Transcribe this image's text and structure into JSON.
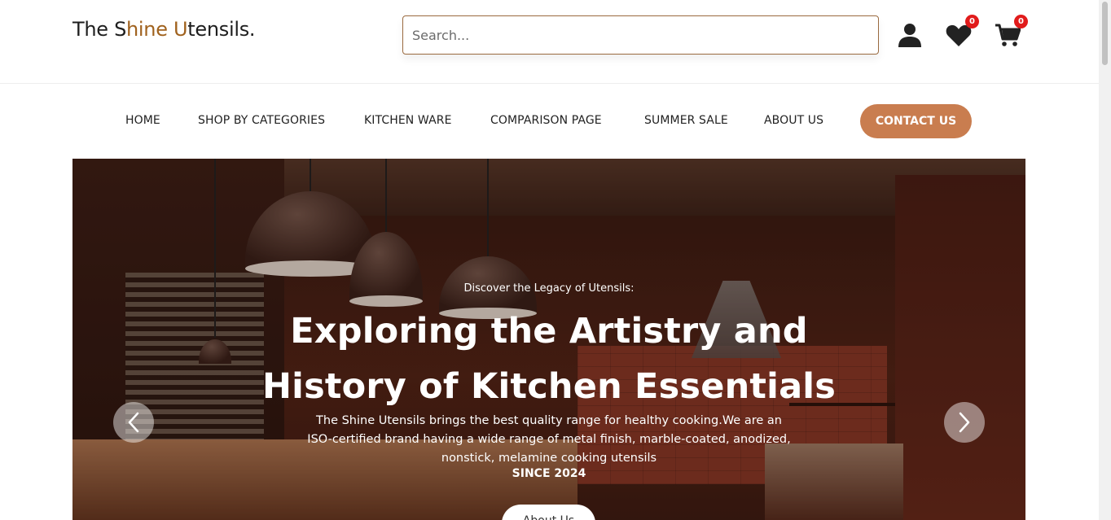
{
  "header": {
    "logo": {
      "part1": "The S",
      "part2": "hine",
      "part3": " ",
      "part4": "U",
      "part5": "tensils."
    },
    "search": {
      "placeholder": "Search...",
      "value": ""
    },
    "wishlist_count": "0",
    "cart_count": "0"
  },
  "nav": {
    "items": [
      {
        "label": "HOME"
      },
      {
        "label": "SHOP BY CATEGORIES"
      },
      {
        "label": "KITCHEN WARE"
      },
      {
        "label": "COMPARISON PAGE"
      },
      {
        "label": "SUMMER SALE"
      },
      {
        "label": "ABOUT US"
      }
    ],
    "contact_label": "CONTACT US"
  },
  "hero": {
    "pre_title": "Discover the Legacy of Utensils:",
    "title_line1": "Exploring the Artistry and",
    "title_line2": "History of Kitchen Essentials",
    "description": "The Shine Utensils brings the best quality range for healthy cooking.We are an ISO-certified brand having a wide range of metal finish, marble-coated, anodized, nonstick, melamine cooking utensils",
    "since": "SINCE 2024",
    "button_label": "About Us"
  },
  "colors": {
    "accent": "#c97d4f",
    "logo_accent": "#a0621e",
    "badge": "#e11b1b",
    "search_border": "#9a6a3f"
  },
  "icons": {
    "account": "user-icon",
    "wishlist": "heart-icon",
    "cart": "cart-icon",
    "prev": "chevron-left-icon",
    "next": "chevron-right-icon"
  }
}
